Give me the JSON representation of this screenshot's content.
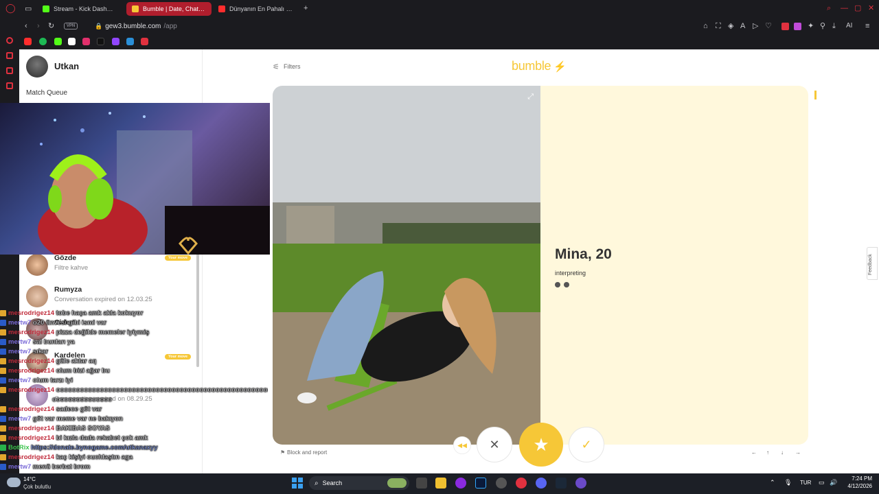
{
  "browser": {
    "tabs": [
      {
        "label": "Stream - Kick Dashboard",
        "fav_color": "#53fc18"
      },
      {
        "label": "Bumble | Date, Chat, Meet",
        "fav_color": "#f6c737"
      },
      {
        "label": "Dünyanın En Pahalı Evi / N",
        "fav_color": "#ff2d2d"
      }
    ],
    "vpn_label": "VPN",
    "url_host": "gew3.bumble.com",
    "url_path": "/app",
    "ai_label": "AI"
  },
  "sidebar": {
    "user_name": "Utkan",
    "match_queue_label": "Match Queue",
    "matches": [
      {
        "name": "Gözde",
        "subtitle": "Filtre kahve",
        "pill": "Your move"
      },
      {
        "name": "Rumyza",
        "subtitle": "Conversation expired on 12.03.25",
        "pill": ""
      },
      {
        "name": "Cidem",
        "subtitle": "",
        "pill": ""
      },
      {
        "name": "Kardelen",
        "subtitle": "",
        "pill": "Your move"
      },
      {
        "name": "",
        "subtitle": "Conversation expired on 08.29.25",
        "pill": ""
      }
    ]
  },
  "main": {
    "filters_label": "Filters",
    "logo_text": "bumble",
    "profile": {
      "name_age": "Mina, 20",
      "interest": "interpreting"
    },
    "block_report_label": "Block and report",
    "feedback_label": "Feedback",
    "colors": {
      "brand": "#f6c737",
      "panel": "#fff8dc"
    }
  },
  "chat_overlay": [
    {
      "user": "mesrodrigez14",
      "msg": "tobe haça amk akla kokuyor",
      "badge": "b2"
    },
    {
      "user": "mertw7",
      "msg": "o20 ünvesi gibi ismi var",
      "badge": "b1"
    },
    {
      "user": "mesrodrigez14",
      "msg": "pizza değilde memeler iyiymiş",
      "badge": "b2"
    },
    {
      "user": "mertw7",
      "msg": "sal bunları ya",
      "badge": "b1"
    },
    {
      "user": "mertw7",
      "msg": "sıkar",
      "badge": "b1"
    },
    {
      "user": "mesrodrigez14",
      "msg": "güle aktar aq",
      "badge": "b2"
    },
    {
      "user": "mesrodrigez14",
      "msg": "olum bizi ağar bu",
      "badge": "b2"
    },
    {
      "user": "mertw7",
      "msg": "olum tarzı iyi",
      "badge": "b1"
    },
    {
      "user": "mesrodrigez14",
      "msg": "oooooooooooooooooooooooooooooooooooooooooooooooooooooooo",
      "badge": "b2"
    },
    {
      "user": "",
      "msg": "ooooooooooooooo",
      "badge": ""
    },
    {
      "user": "mesrodrigez14",
      "msg": "sadece göt var",
      "badge": "b2"
    },
    {
      "user": "mertw7",
      "msg": "göt var meme var ne bakıyon",
      "badge": "b1"
    },
    {
      "user": "mesrodrigez14",
      "msg": "BAKIBAS SOYAS",
      "badge": "b2"
    },
    {
      "user": "mesrodrigez14",
      "msg": "bi kızla dada rekabet çok amk",
      "badge": "b2"
    },
    {
      "user": "BotRix",
      "msg": "https://donate.bynogame.com/utkanaxyy",
      "badge": "b3"
    },
    {
      "user": "mesrodrigez14",
      "msg": "kaç kişiyi ouchlaştın aga",
      "badge": "b2"
    },
    {
      "user": "mertw7",
      "msg": "menü berbat brom",
      "badge": "b1"
    }
  ],
  "taskbar": {
    "weather_temp": "14°C",
    "weather_desc": "Çok bulutlu",
    "search_label": "Search",
    "lang": "TUR",
    "time": "7:24 PM",
    "date": "4/12/2026"
  }
}
